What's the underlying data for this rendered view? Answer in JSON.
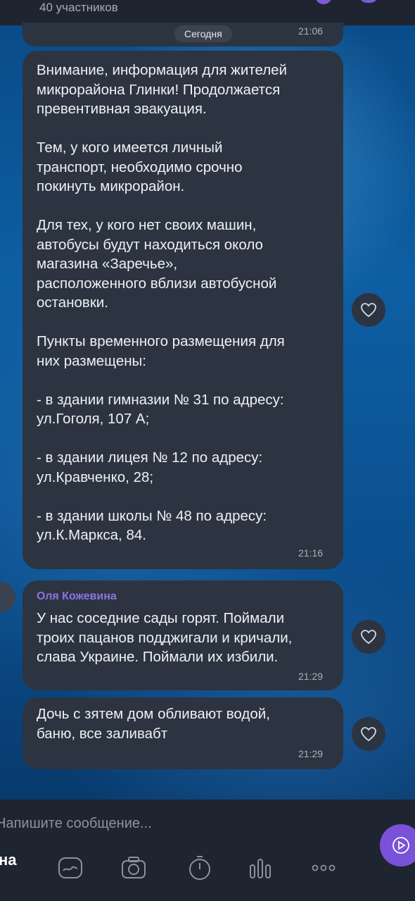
{
  "header": {
    "subtitle": "40 участников"
  },
  "date_separator": {
    "label": "Сегодня",
    "time": "21:06"
  },
  "messages": [
    {
      "text": "Внимание, информация для жителей\nмикрорайона Глинки! Продолжается\nпревентивная эвакуация.\n\nТем, у кого имеется личный\nтранспорт, необходимо срочно\nпокинуть микрорайон.\n\nДля тех, у кого нет своих машин,\nавтобусы будут находиться около\nмагазина «Заречье»,\nрасположенного вблизи автобусной\nостановки.\n\nПункты временного размещения для\nних размещены:\n\n- в здании гимназии № 31 по адресу:\nул.Гоголя, 107 А;\n\n- в здании лицея № 12 по адресу:\nул.Кравченко, 28;\n\n- в здании школы № 48 по адресу:\nул.К.Маркса, 84.",
      "time": "21:16"
    },
    {
      "sender": "Оля Кожевина",
      "text": "У нас соседние сады горят. Поймали\nтроих пацанов подджигали и кричали,\nслава Украине. Поймали их избили.",
      "time": "21:29"
    },
    {
      "text": "Дочь с зятем дом обливают водой,\nбаню, все заливабт",
      "time": "21:29"
    }
  ],
  "composer": {
    "placeholder": "Напишите сообщение...",
    "edge_label": "на"
  },
  "colors": {
    "bubble": "#2d3441",
    "accent": "#7a52d9",
    "sender_name": "#8e72e6"
  },
  "icons": [
    "heart-icon",
    "send-icon",
    "sticker-icon",
    "camera-icon",
    "timer-icon",
    "audio-icon",
    "more-icon"
  ]
}
